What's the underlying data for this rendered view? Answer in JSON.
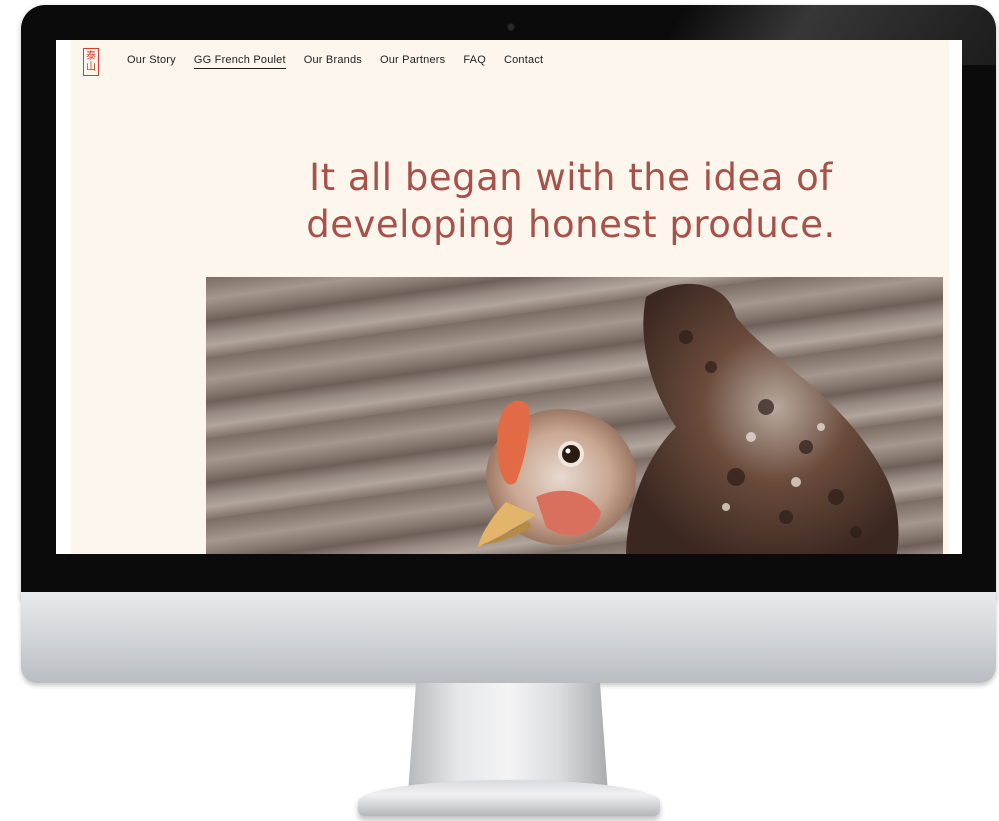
{
  "site": {
    "logo_glyphs": [
      "泰",
      "山"
    ],
    "nav": [
      {
        "label": "Our Story",
        "active": false
      },
      {
        "label": "GG French Poulet",
        "active": true
      },
      {
        "label": "Our Brands",
        "active": false
      },
      {
        "label": "Our Partners",
        "active": false
      },
      {
        "label": "FAQ",
        "active": false
      },
      {
        "label": "Contact",
        "active": false
      }
    ],
    "headline_line1": "It all began with the idea of",
    "headline_line2": "developing honest produce."
  },
  "colors": {
    "page_background": "#fdf6ec",
    "headline": "#a8514a",
    "logo": "#d63b2f",
    "nav_text": "#1f1f1f"
  },
  "icons": {
    "logo": "red-chinese-characters-seal",
    "camera": "webcam-dot"
  }
}
